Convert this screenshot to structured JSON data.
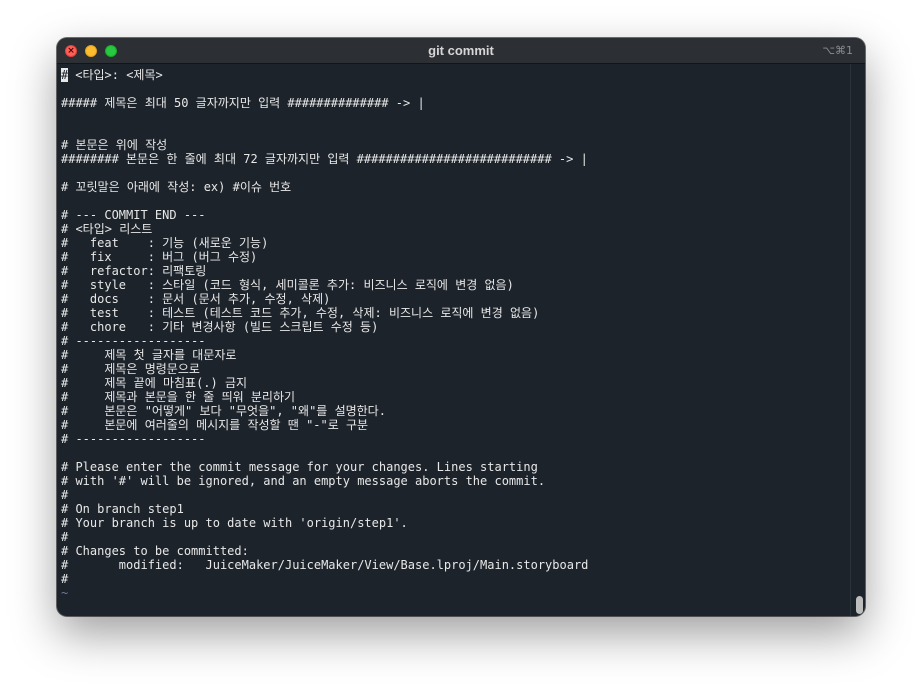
{
  "window": {
    "title": "git commit",
    "shortcut": "⌥⌘1"
  },
  "terminal": {
    "cursor_char": "#",
    "first_line_rest": " <타입>: <제목>",
    "lines": [
      "##### 제목은 최대 50 글자까지만 입력 ############## -> |",
      "# 본문은 위에 작성",
      "######## 본문은 한 줄에 최대 72 글자까지만 입력 ########################### -> |",
      "# 꼬릿말은 아래에 작성: ex) #이슈 번호",
      "# --- COMMIT END ---",
      "# <타입> 리스트",
      "#   feat    : 기능 (새로운 기능)",
      "#   fix     : 버그 (버그 수정)",
      "#   refactor: 리팩토링",
      "#   style   : 스타일 (코드 형식, 세미콜론 추가: 비즈니스 로직에 변경 없음)",
      "#   docs    : 문서 (문서 추가, 수정, 삭제)",
      "#   test    : 테스트 (테스트 코드 추가, 수정, 삭제: 비즈니스 로직에 변경 없음)",
      "#   chore   : 기타 변경사항 (빌드 스크립트 수정 등)",
      "# ------------------",
      "#     제목 첫 글자를 대문자로",
      "#     제목은 명령문으로",
      "#     제목 끝에 마침표(.) 금지",
      "#     제목과 본문을 한 줄 띄워 분리하기",
      "#     본문은 \"어떻게\" 보다 \"무엇을\", \"왜\"를 설명한다.",
      "#     본문에 여러줄의 메시지를 작성할 땐 \"-\"로 구분",
      "# ------------------",
      "# Please enter the commit message for your changes. Lines starting",
      "# with '#' will be ignored, and an empty message aborts the commit.",
      "#",
      "# On branch step1",
      "# Your branch is up to date with 'origin/step1'.",
      "#",
      "# Changes to be committed:",
      "#       modified:   JuiceMaker/JuiceMaker/View/Base.lproj/Main.storyboard",
      "#",
      "~"
    ]
  }
}
